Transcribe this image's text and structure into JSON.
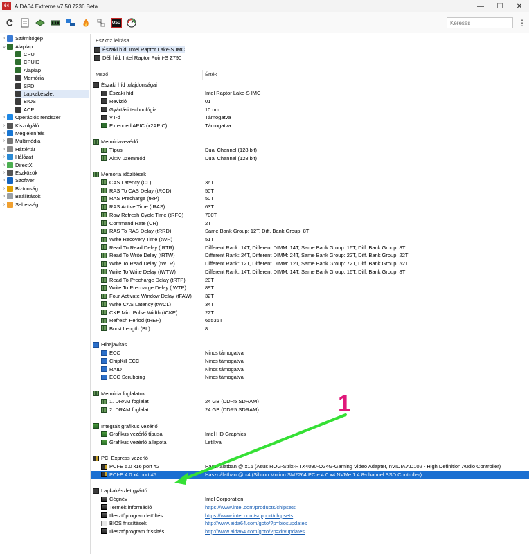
{
  "window": {
    "title": "AIDA64 Extreme v7.50.7236 Beta",
    "app_icon_text": "64",
    "minimize": "—",
    "maximize": "☐",
    "close": "✕"
  },
  "toolbar": {
    "icons": [
      "refresh-icon",
      "report-icon",
      "motherboard-icon",
      "memory-icon",
      "network-icon",
      "flame-icon",
      "network-share-icon",
      "osd-icon",
      "benchmark-gauge-icon"
    ],
    "osd_label": "OSD",
    "search_placeholder": "Keresés",
    "more": "⋮"
  },
  "sidebar": {
    "items": [
      {
        "label": "Számítógép",
        "chev": "›",
        "color": "#3a7bd5"
      },
      {
        "label": "Alaplap",
        "chev": "⌄",
        "color": "#2f6f2f"
      },
      {
        "label": "CPU",
        "chev": "",
        "color": "#2f6f2f"
      },
      {
        "label": "CPUID",
        "chev": "",
        "color": "#2f6f2f"
      },
      {
        "label": "Alaplap",
        "chev": "",
        "color": "#2f6f2f"
      },
      {
        "label": "Memória",
        "chev": "",
        "color": "#3c3c3c"
      },
      {
        "label": "SPD",
        "chev": "",
        "color": "#3c3c3c"
      },
      {
        "label": "Lapkakészlet",
        "chev": "",
        "color": "#3c3c3c"
      },
      {
        "label": "BIOS",
        "chev": "",
        "color": "#3c3c3c"
      },
      {
        "label": "ACPI",
        "chev": "",
        "color": "#3c3c3c"
      },
      {
        "label": "Operációs rendszer",
        "chev": "›",
        "color": "#1e88e5"
      },
      {
        "label": "Kiszolgáló",
        "chev": "›",
        "color": "#555555"
      },
      {
        "label": "Megjelenítés",
        "chev": "›",
        "color": "#1976d2"
      },
      {
        "label": "Multimédia",
        "chev": "›",
        "color": "#777777"
      },
      {
        "label": "Háttértár",
        "chev": "›",
        "color": "#888888"
      },
      {
        "label": "Hálózat",
        "chev": "›",
        "color": "#2a8ad4"
      },
      {
        "label": "DirectX",
        "chev": "›",
        "color": "#4caf50"
      },
      {
        "label": "Eszközök",
        "chev": "›",
        "color": "#555555"
      },
      {
        "label": "Szoftver",
        "chev": "›",
        "color": "#1565c0"
      },
      {
        "label": "Biztonság",
        "chev": "›",
        "color": "#e0a000"
      },
      {
        "label": "Beállítások",
        "chev": "›",
        "color": "#9aa0a6"
      },
      {
        "label": "Sebesség",
        "chev": "›",
        "color": "#f0a030"
      }
    ]
  },
  "devices": {
    "header": "Eszköz leírása",
    "items": [
      {
        "label": "Északi híd: Intel Raptor Lake-S IMC"
      },
      {
        "label": "Déli híd: Intel Raptor Point-S Z790"
      }
    ]
  },
  "columns": {
    "field": "Mező",
    "value": "Érték"
  },
  "rows": [
    {
      "kind": "group",
      "icon": "chip-ic",
      "field": "Északi híd tulajdonságai",
      "value": ""
    },
    {
      "kind": "item",
      "icon": "chip-ic",
      "field": "Északi híd",
      "value": "Intel Raptor Lake-S IMC"
    },
    {
      "kind": "item",
      "icon": "chip-ic",
      "field": "Revízió",
      "value": "01"
    },
    {
      "kind": "item",
      "icon": "chip-ic",
      "field": "Gyártási technológia",
      "value": "10 nm"
    },
    {
      "kind": "item",
      "icon": "chip-ic",
      "field": "VT-d",
      "value": "Támogatva"
    },
    {
      "kind": "item",
      "icon": "mb-ic",
      "field": "Extended APIC (x2APIC)",
      "value": "Támogatva"
    },
    {
      "kind": "blank"
    },
    {
      "kind": "group",
      "icon": "ram-ic",
      "field": "Memóriavezérlő",
      "value": ""
    },
    {
      "kind": "item",
      "icon": "ram-ic",
      "field": "Típus",
      "value": "Dual Channel  (128 bit)"
    },
    {
      "kind": "item",
      "icon": "ram-ic",
      "field": "Aktív üzemmód",
      "value": "Dual Channel  (128 bit)"
    },
    {
      "kind": "blank"
    },
    {
      "kind": "group",
      "icon": "ram-ic",
      "field": "Memória időzítések",
      "value": ""
    },
    {
      "kind": "item",
      "icon": "ram-ic",
      "field": "CAS Latency (CL)",
      "value": "36T"
    },
    {
      "kind": "item",
      "icon": "ram-ic",
      "field": "RAS To CAS Delay (tRCD)",
      "value": "50T"
    },
    {
      "kind": "item",
      "icon": "ram-ic",
      "field": "RAS Precharge (tRP)",
      "value": "50T"
    },
    {
      "kind": "item",
      "icon": "ram-ic",
      "field": "RAS Active Time (tRAS)",
      "value": "63T"
    },
    {
      "kind": "item",
      "icon": "ram-ic",
      "field": "Row Refresh Cycle Time (tRFC)",
      "value": "700T"
    },
    {
      "kind": "item",
      "icon": "ram-ic",
      "field": "Command Rate (CR)",
      "value": "2T"
    },
    {
      "kind": "item",
      "icon": "ram-ic",
      "field": "RAS To RAS Delay (tRRD)",
      "value": "Same Bank Group: 12T, Diff. Bank Group: 8T"
    },
    {
      "kind": "item",
      "icon": "ram-ic",
      "field": "Write Recovery Time (tWR)",
      "value": "51T"
    },
    {
      "kind": "item",
      "icon": "ram-ic",
      "field": "Read To Read Delay (tRTR)",
      "value": "Different Rank: 14T, Different DIMM: 14T, Same Bank Group: 16T, Diff. Bank Group: 8T"
    },
    {
      "kind": "item",
      "icon": "ram-ic",
      "field": "Read To Write Delay (tRTW)",
      "value": "Different Rank: 24T, Different DIMM: 24T, Same Bank Group: 22T, Diff. Bank Group: 22T"
    },
    {
      "kind": "item",
      "icon": "ram-ic",
      "field": "Write To Read Delay (tWTR)",
      "value": "Different Rank: 12T, Different DIMM: 12T, Same Bank Group: 72T, Diff. Bank Group: 52T"
    },
    {
      "kind": "item",
      "icon": "ram-ic",
      "field": "Write To Write Delay (tWTW)",
      "value": "Different Rank: 14T, Different DIMM: 14T, Same Bank Group: 16T, Diff. Bank Group: 8T"
    },
    {
      "kind": "item",
      "icon": "ram-ic",
      "field": "Read To Precharge Delay (tRTP)",
      "value": "20T"
    },
    {
      "kind": "item",
      "icon": "ram-ic",
      "field": "Write To Precharge Delay (tWTP)",
      "value": "89T"
    },
    {
      "kind": "item",
      "icon": "ram-ic",
      "field": "Four Activate Window Delay (tFAW)",
      "value": "32T"
    },
    {
      "kind": "item",
      "icon": "ram-ic",
      "field": "Write CAS Latency (tWCL)",
      "value": "34T"
    },
    {
      "kind": "item",
      "icon": "ram-ic",
      "field": "CKE Min. Pulse Width (tCKE)",
      "value": "22T"
    },
    {
      "kind": "item",
      "icon": "ram-ic",
      "field": "Refresh Period (tREF)",
      "value": "65536T"
    },
    {
      "kind": "item",
      "icon": "ram-ic",
      "field": "Burst Length (BL)",
      "value": "8"
    },
    {
      "kind": "blank"
    },
    {
      "kind": "group",
      "icon": "blue-ic",
      "field": "Hibajavítás",
      "value": ""
    },
    {
      "kind": "item",
      "icon": "blue-ic",
      "field": "ECC",
      "value": "Nincs támogatva"
    },
    {
      "kind": "item",
      "icon": "blue-ic",
      "field": "ChipKill ECC",
      "value": "Nincs támogatva"
    },
    {
      "kind": "item",
      "icon": "blue-ic",
      "field": "RAID",
      "value": "Nincs támogatva"
    },
    {
      "kind": "item",
      "icon": "blue-ic",
      "field": "ECC Scrubbing",
      "value": "Nincs támogatva"
    },
    {
      "kind": "blank"
    },
    {
      "kind": "group",
      "icon": "ram-ic",
      "field": "Memória foglalatok",
      "value": ""
    },
    {
      "kind": "item",
      "icon": "ram-ic",
      "field": "1. DRAM foglalat",
      "value": "24 GB  (DDR5 SDRAM)"
    },
    {
      "kind": "item",
      "icon": "ram-ic",
      "field": "2. DRAM foglalat",
      "value": "24 GB  (DDR5 SDRAM)"
    },
    {
      "kind": "blank"
    },
    {
      "kind": "group",
      "icon": "gpu-ic",
      "field": "Integrált grafikus vezérlő",
      "value": ""
    },
    {
      "kind": "item",
      "icon": "gpu-ic",
      "field": "Grafikus vezérlő típusa",
      "value": "Intel HD Graphics"
    },
    {
      "kind": "item",
      "icon": "gpu-ic",
      "field": "Grafikus vezérlő állapota",
      "value": "Letiltva"
    },
    {
      "kind": "blank"
    },
    {
      "kind": "group",
      "icon": "slot-ic",
      "field": "PCI Express vezérlő",
      "value": ""
    },
    {
      "kind": "item",
      "icon": "slot-ic",
      "field": "PCI-E 5.0 x16 port #2",
      "value": "Használatban @ x16  (Asus ROG-Strix-RTX4090-O24G-Gaming Video Adapter, nVIDIA AD102 - High Definition Audio Controller)"
    },
    {
      "kind": "item",
      "icon": "slot-ic",
      "field": "PCI-E 4.0 x4 port #5",
      "value": "Használatban @ x4  (Silicon Motion SM2264 PCIe 4.0 x4 NVMe 1.4 8-channel SSD Controller)",
      "highlight": true
    },
    {
      "kind": "blank"
    },
    {
      "kind": "group",
      "icon": "chip-ic",
      "field": "Lapkakészlet gyártó",
      "value": ""
    },
    {
      "kind": "item",
      "icon": "vendor-ic",
      "field": "Cégnév",
      "value": "Intel Corporation"
    },
    {
      "kind": "item",
      "icon": "vendor-ic",
      "field": "Termék információ",
      "value": "https://www.intel.com/products/chipsets",
      "link": true
    },
    {
      "kind": "item",
      "icon": "vendor-ic",
      "field": "Illesztőprogram letöltés",
      "value": "https://www.intel.com/support/chipsets",
      "link": true
    },
    {
      "kind": "item",
      "icon": "info-ic",
      "field": "BIOS frissítések",
      "value": "http://www.aida64.com/goto/?p=biosupdates",
      "link": true
    },
    {
      "kind": "item",
      "icon": "vendor-ic",
      "field": "Illesztőprogram frissítés",
      "value": "http://www.aida64.com/goto/?p=drvupdates",
      "link": true
    }
  ],
  "annotation": {
    "label": "1",
    "color": "#e0187a",
    "arrow_color": "#35e035"
  }
}
